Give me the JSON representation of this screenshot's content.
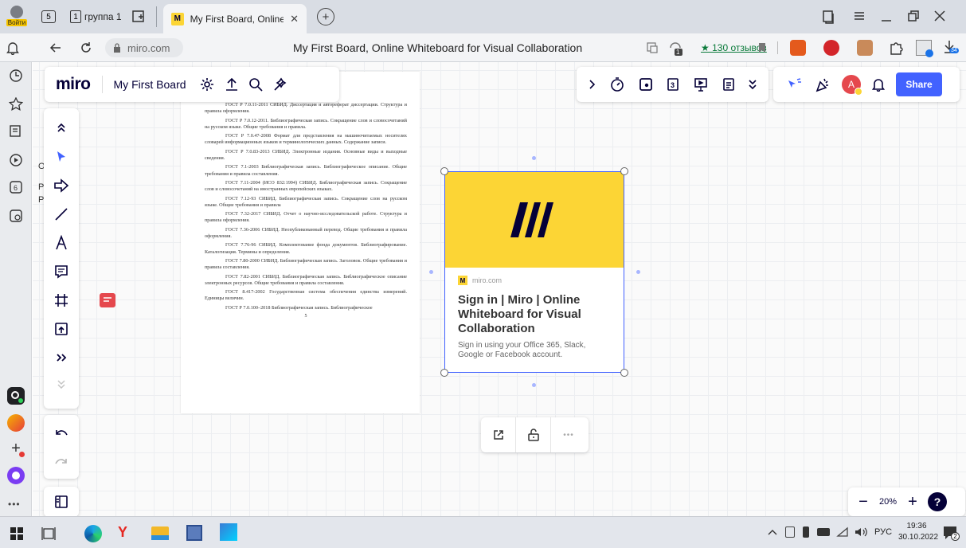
{
  "browser": {
    "login_label": "Войти",
    "tab_count": "5",
    "group_tab": "группа 1",
    "group_count": "1",
    "active_tab_title": "My First Board, Online W",
    "new_tab": "+",
    "url": "miro.com",
    "page_title": "My First Board, Online Whiteboard for Visual Collaboration",
    "reviews": "★ 130 отзывов",
    "ext_badge": "1",
    "download_badge": "34"
  },
  "board": {
    "logo": "miro",
    "name": "My First Board",
    "share": "Share",
    "avatar": "A",
    "zoom": "20%",
    "zoom_minus": "−",
    "zoom_plus": "+",
    "help": "?"
  },
  "document": {
    "paragraphs": [
      "ГОСТ Р 7.0.11-2011 СИБИД. Диссертация и автореферат диссертации. Структура и правила оформления.",
      "ГОСТ Р 7.0.12-2011. Библиографическая запись. Сокращение слов и словосочетаний на русском языке. Общие требования и правила.",
      "ГОСТ Р 7.0.47-2008 Формат для представления на машиночитаемых носителях словарей информационных языков и терминологических данных. Содержание записи.",
      "ГОСТ Р 7.0.83-2013 СИБИД. Электронные издания. Основные виды и выходные сведения.",
      "ГОСТ 7.1-2003 Библиографическая запись. Библиографическое описание. Общие требования и правила составления.",
      "ГОСТ 7.11-2004 (ИСО 832:1994) СИБИД. Библиографическая запись. Сокращение слов и словосочетаний на иностранных европейских языках.",
      "ГОСТ 7.12-93 СИБИД. Библиографическая запись. Сокращение слов на русском языке. Общие требования и правила",
      "ГОСТ 7.32-2017 СИБИД. Отчет о научно-исследовательской работе. Структура и правила оформления.",
      "ГОСТ 7.36-2006 СИБИД. Неопубликованный перевод. Общие требования и правила оформления.",
      "ГОСТ 7.76-96 СИБИД. Комплектование фонда документов. Библиографирование. Каталогизация. Термины и определения.",
      "ГОСТ 7.80-2000 СИБИД. Библиографическая запись. Заголовок. Общие требования и правила составления.",
      "ГОСТ 7.82-2001 СИБИД. Библиографическая запись. Библиографическое описание электронных ресурсов. Общие требования и правила составления.",
      "ГОСТ 8.417-2002 Государственная система обеспечения единства измерений. Единицы величин.",
      "ГОСТ Р 7.0.100–2018 Библиографическая запись. Библиографическое"
    ],
    "page_number": "5"
  },
  "card": {
    "domain": "miro.com",
    "title": "Sign in | Miro | Online Whiteboard for Visual Collaboration",
    "description": "Sign in using your Office 365, Slack, Google or Facebook account.",
    "banner_color": "#fcd535",
    "logo_color": "#050038"
  },
  "sticky": {
    "color": "#a5d98a",
    "fragments": [
      "O",
      "Р",
      "Р"
    ]
  },
  "taskbar": {
    "lang": "РУС",
    "time": "19:36",
    "date": "30.10.2022",
    "notif": "2"
  },
  "colors": {
    "accent": "#4262ff",
    "comment": "#e5484d"
  }
}
